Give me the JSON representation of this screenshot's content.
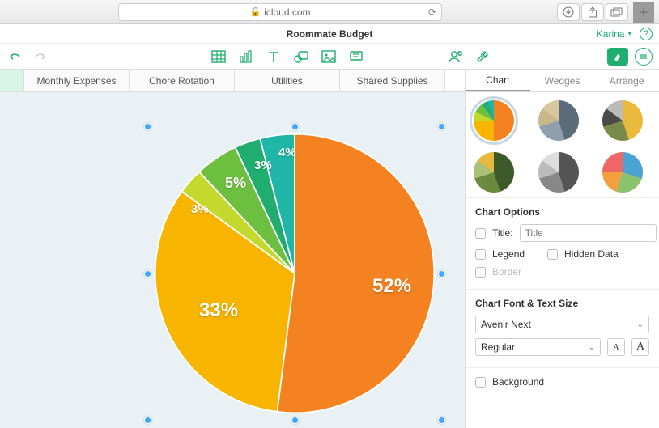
{
  "browser": {
    "url_host": "icloud.com"
  },
  "doc": {
    "title": "Roommate Budget",
    "user": "Karina"
  },
  "tabs": [
    "Monthly Expenses",
    "Chore Rotation",
    "Utilities",
    "Shared Supplies"
  ],
  "inspector": {
    "tabs": [
      "Chart",
      "Wedges",
      "Arrange"
    ],
    "active_tab": 0,
    "options_title": "Chart Options",
    "title_label": "Title:",
    "title_placeholder": "Title",
    "legend_label": "Legend",
    "hidden_label": "Hidden Data",
    "border_label": "Border",
    "font_section": "Chart Font & Text Size",
    "font_family": "Avenir Next",
    "font_weight": "Regular",
    "background_label": "Background"
  },
  "chart_data": {
    "type": "pie",
    "title": "",
    "slices": [
      {
        "label": "52%",
        "value": 52,
        "color": "#f58220"
      },
      {
        "label": "33%",
        "value": 33,
        "color": "#f7b500"
      },
      {
        "label": "3%",
        "value": 3,
        "color": "#c4d92e"
      },
      {
        "label": "5%",
        "value": 5,
        "color": "#6cbf3f"
      },
      {
        "label": "3%",
        "value": 3,
        "color": "#1fae6f"
      },
      {
        "label": "4%",
        "value": 4,
        "color": "#1fb5a7"
      }
    ],
    "start_angle_deg": -90,
    "label_color": "#ffffff"
  }
}
